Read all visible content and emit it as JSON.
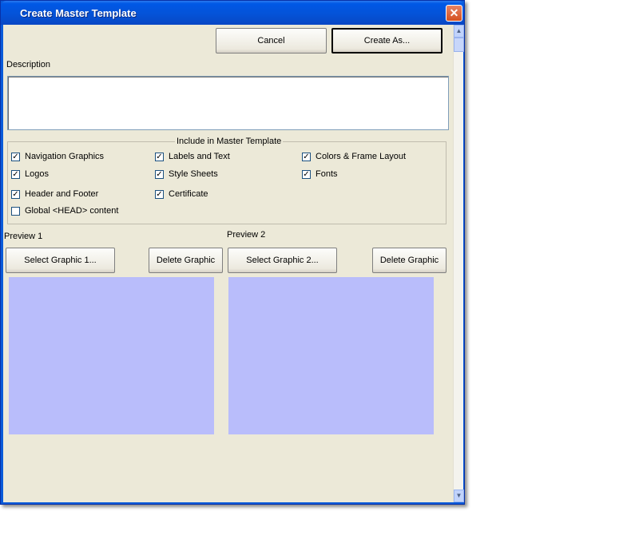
{
  "window": {
    "title": "Create Master Template",
    "close_glyph": "✕"
  },
  "toolbar": {
    "cancel_label": "Cancel",
    "create_as_label": "Create As..."
  },
  "description": {
    "label": "Description",
    "value": ""
  },
  "include_group": {
    "legend": "Include in Master Template",
    "items": [
      {
        "label": "Navigation Graphics",
        "checked": true
      },
      {
        "label": "Labels and Text",
        "checked": true
      },
      {
        "label": "Colors & Frame Layout",
        "checked": true
      },
      {
        "label": "Logos",
        "checked": true
      },
      {
        "label": "Style Sheets",
        "checked": true
      },
      {
        "label": "Fonts",
        "checked": true
      },
      {
        "label": "Header and Footer",
        "checked": true
      },
      {
        "label": "Certificate",
        "checked": true
      },
      {
        "label": "Global <HEAD> content",
        "checked": false
      }
    ]
  },
  "preview1": {
    "label": "Preview 1",
    "select_label": "Select Graphic 1...",
    "delete_label": "Delete Graphic"
  },
  "preview2": {
    "label": "Preview 2",
    "select_label": "Select Graphic 2...",
    "delete_label": "Delete Graphic"
  },
  "scrollbar": {
    "up_glyph": "▲",
    "down_glyph": "▼"
  },
  "colors": {
    "preview_fill": "#b9bdfb",
    "title_bar": "#0453d8",
    "dialog_bg": "#ece9d8"
  }
}
